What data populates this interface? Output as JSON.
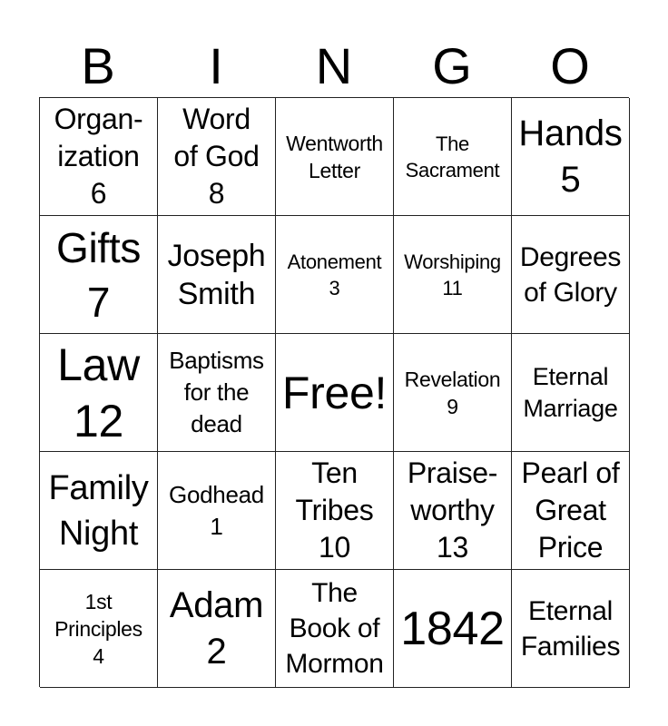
{
  "header": {
    "letters": [
      "B",
      "I",
      "N",
      "G",
      "O"
    ]
  },
  "grid": {
    "rows": [
      [
        {
          "text": "Organ-\nization\n6",
          "size": "s32"
        },
        {
          "text": "Word\nof God\n8",
          "size": "s32"
        },
        {
          "text": "Wentworth\nLetter",
          "size": "s23"
        },
        {
          "text": "The\nSacrament",
          "size": "s22"
        },
        {
          "text": "Hands\n5",
          "size": "s40"
        }
      ],
      [
        {
          "text": "Gifts\n7",
          "size": "s46"
        },
        {
          "text": "Joseph\nSmith",
          "size": "s34"
        },
        {
          "text": "Atonement\n3",
          "size": "s22"
        },
        {
          "text": "Worshiping\n11",
          "size": "s22"
        },
        {
          "text": "Degrees\nof Glory",
          "size": "s30"
        }
      ],
      [
        {
          "text": "Law\n12",
          "size": "s50"
        },
        {
          "text": "Baptisms\nfor the\ndead",
          "size": "s26"
        },
        {
          "text": "Free!",
          "size": "s50"
        },
        {
          "text": "Revelation\n9",
          "size": "s23"
        },
        {
          "text": "Eternal\nMarriage",
          "size": "s27"
        }
      ],
      [
        {
          "text": "Family\nNight",
          "size": "s38"
        },
        {
          "text": "Godhead\n1",
          "size": "s26"
        },
        {
          "text": "Ten\nTribes\n10",
          "size": "s32"
        },
        {
          "text": "Praise-\nworthy\n13",
          "size": "s32"
        },
        {
          "text": "Pearl of\nGreat\nPrice",
          "size": "s32"
        }
      ],
      [
        {
          "text": "1st\nPrinciples\n4",
          "size": "s23"
        },
        {
          "text": "Adam\n2",
          "size": "s40"
        },
        {
          "text": "The\nBook of\nMormon",
          "size": "s30"
        },
        {
          "text": "1842",
          "size": "s52"
        },
        {
          "text": "Eternal\nFamilies",
          "size": "s30"
        }
      ]
    ]
  }
}
